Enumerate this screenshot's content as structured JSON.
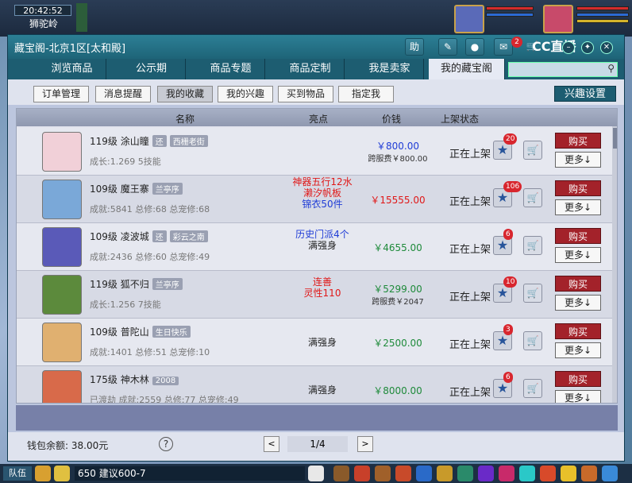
{
  "game_hud": {
    "clock": "20:42:52",
    "location": "狮驼岭"
  },
  "window": {
    "title": "藏宝阁-北京1区[太和殿]",
    "help_label": "助",
    "message_count": "2",
    "cc_logo": "CC直播"
  },
  "tabs": [
    {
      "label": "浏览商品"
    },
    {
      "label": "公示期"
    },
    {
      "label": "商品专题"
    },
    {
      "label": "商品定制"
    },
    {
      "label": "我是卖家"
    },
    {
      "label": "我的藏宝阁"
    }
  ],
  "search": {
    "placeholder": ""
  },
  "subtabs": [
    {
      "label": "订单管理"
    },
    {
      "label": "消息提醒"
    },
    {
      "label": "我的收藏"
    },
    {
      "label": "我的兴趣"
    },
    {
      "label": "买到物品"
    },
    {
      "label": "指定我"
    }
  ],
  "interest_button": "兴趣设置",
  "columns": {
    "name": "名称",
    "highlight": "亮点",
    "price": "价钱",
    "status": "上架状态"
  },
  "items": [
    {
      "level": "119级",
      "name": "涂山瞳",
      "tags": [
        "还",
        "西栅老街"
      ],
      "stats": "成长:1.269 5技能",
      "highlights": [],
      "price": "￥800.00",
      "fee": "跨服费￥800.00",
      "status": "正在上架",
      "favs": "20",
      "buy": "购买",
      "more": "更多↓",
      "avatar_color": "#f1d0d8",
      "price_color": "#1f3cd6"
    },
    {
      "level": "109级",
      "name": "魔王寨",
      "tags": [
        "兰亭序"
      ],
      "stats": "成就:5841 总修:68 总宠修:68",
      "highlights": [
        {
          "text": "神器五行12水",
          "color": "#e01818"
        },
        {
          "text": "濑汐帆板",
          "color": "#e01818"
        },
        {
          "text": "锦衣50件",
          "color": "#1f3cd6"
        }
      ],
      "price": "￥15555.00",
      "fee": "",
      "status": "正在上架",
      "favs": "106",
      "buy": "购买",
      "more": "更多↓",
      "avatar_color": "#7aa8d8",
      "price_color": "#e01818"
    },
    {
      "level": "109级",
      "name": "凌波城",
      "tags": [
        "还",
        "彩云之南"
      ],
      "stats": "成就:2436 总修:60 总宠修:49",
      "highlights": [
        {
          "text": "历史门派4个",
          "color": "#1f3cd6"
        },
        {
          "text": "满强身",
          "color": "#222222"
        }
      ],
      "price": "￥4655.00",
      "fee": "",
      "status": "正在上架",
      "favs": "6",
      "buy": "购买",
      "more": "更多↓",
      "avatar_color": "#5a5ab8",
      "price_color": "#1e8a3a"
    },
    {
      "level": "119级",
      "name": "狐不归",
      "tags": [
        "兰亭序"
      ],
      "stats": "成长:1.256 7技能",
      "highlights": [
        {
          "text": "连善",
          "color": "#e01818"
        },
        {
          "text": "灵性110",
          "color": "#e01818"
        }
      ],
      "price": "￥5299.00",
      "fee": "跨服费￥2047",
      "status": "正在上架",
      "favs": "10",
      "buy": "购买",
      "more": "更多↓",
      "avatar_color": "#5c8a3c",
      "price_color": "#1e8a3a"
    },
    {
      "level": "109级",
      "name": "普陀山",
      "tags": [
        "生日快乐"
      ],
      "stats": "成就:1401 总修:51 总宠修:10",
      "highlights": [
        {
          "text": "满强身",
          "color": "#222222"
        }
      ],
      "price": "￥2500.00",
      "fee": "",
      "status": "正在上架",
      "favs": "3",
      "buy": "购买",
      "more": "更多↓",
      "avatar_color": "#e0b070",
      "price_color": "#1e8a3a"
    },
    {
      "level": "175级",
      "name": "神木林",
      "tags": [
        "2008"
      ],
      "stats": "已渡劫 成就:2559 总修:77 总宠修:49",
      "highlights": [
        {
          "text": "满强身",
          "color": "#222222"
        }
      ],
      "price": "￥8000.00",
      "fee": "",
      "status": "正在上架",
      "favs": "6",
      "buy": "购买",
      "more": "更多↓",
      "avatar_color": "#d86a4a",
      "price_color": "#1e8a3a"
    }
  ],
  "footer": {
    "wallet": "钱包余额: 38.00元",
    "help": "?",
    "prev": "<",
    "page": "1/4",
    "next": ">"
  },
  "chat": {
    "team_label": "队伍",
    "input_value": "650  建议600-7"
  }
}
